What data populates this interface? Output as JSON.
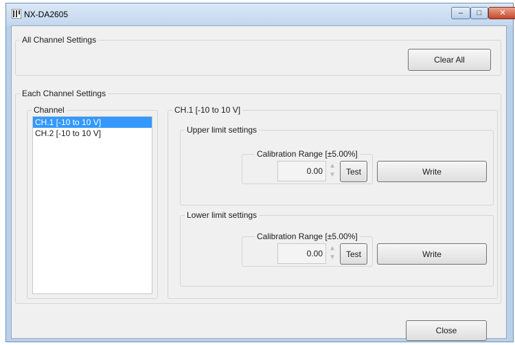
{
  "window": {
    "title": "NX-DA2605"
  },
  "all_channel": {
    "legend": "All Channel Settings",
    "clear_all_label": "Clear All"
  },
  "each_channel": {
    "legend": "Each Channel Settings",
    "channel_list": {
      "legend": "Channel",
      "items": [
        {
          "label": "CH.1  [-10 to 10 V]",
          "selected": true
        },
        {
          "label": "CH.2  [-10 to 10 V]",
          "selected": false
        }
      ]
    },
    "detail": {
      "legend": "CH.1  [-10 to 10 V]",
      "upper": {
        "legend": "Upper limit settings",
        "range_legend": "Calibration Range [±5.00%]",
        "value": "0.00",
        "test_label": "Test",
        "write_label": "Write"
      },
      "lower": {
        "legend": "Lower limit settings",
        "range_legend": "Calibration Range [±5.00%]",
        "value": "0.00",
        "test_label": "Test",
        "write_label": "Write"
      }
    }
  },
  "footer": {
    "close_label": "Close"
  },
  "icons": {
    "spin_up": "▲",
    "spin_down": "▼",
    "minimize": "–",
    "maximize": "□",
    "close": "✕"
  }
}
